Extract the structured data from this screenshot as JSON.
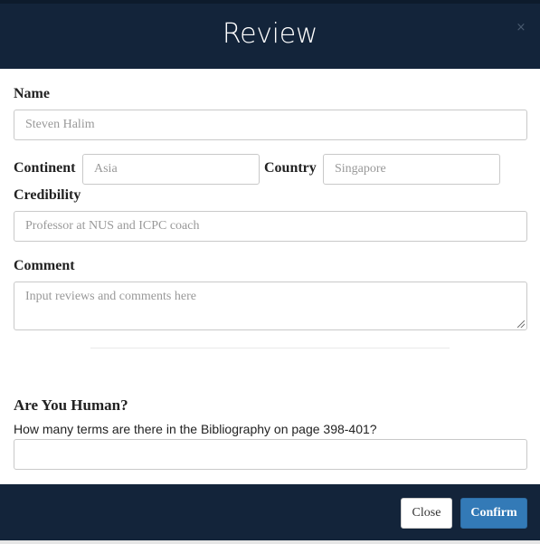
{
  "header": {
    "title": "Review",
    "close_glyph": "×"
  },
  "form": {
    "name": {
      "label": "Name",
      "placeholder": "Steven Halim"
    },
    "continent": {
      "label": "Continent",
      "placeholder": "Asia"
    },
    "country": {
      "label": "Country",
      "placeholder": "Singapore"
    },
    "credibility": {
      "label": "Credibility",
      "placeholder": "Professor at NUS and ICPC coach"
    },
    "comment": {
      "label": "Comment",
      "placeholder": "Input reviews and comments here"
    }
  },
  "captcha": {
    "heading": "Are You Human?",
    "question": "How many terms are there in the Bibliography on page 398-401?",
    "answer_value": ""
  },
  "footer": {
    "close_label": "Close",
    "confirm_label": "Confirm"
  },
  "colors": {
    "header_bg": "#13243a",
    "primary": "#337ab7"
  }
}
